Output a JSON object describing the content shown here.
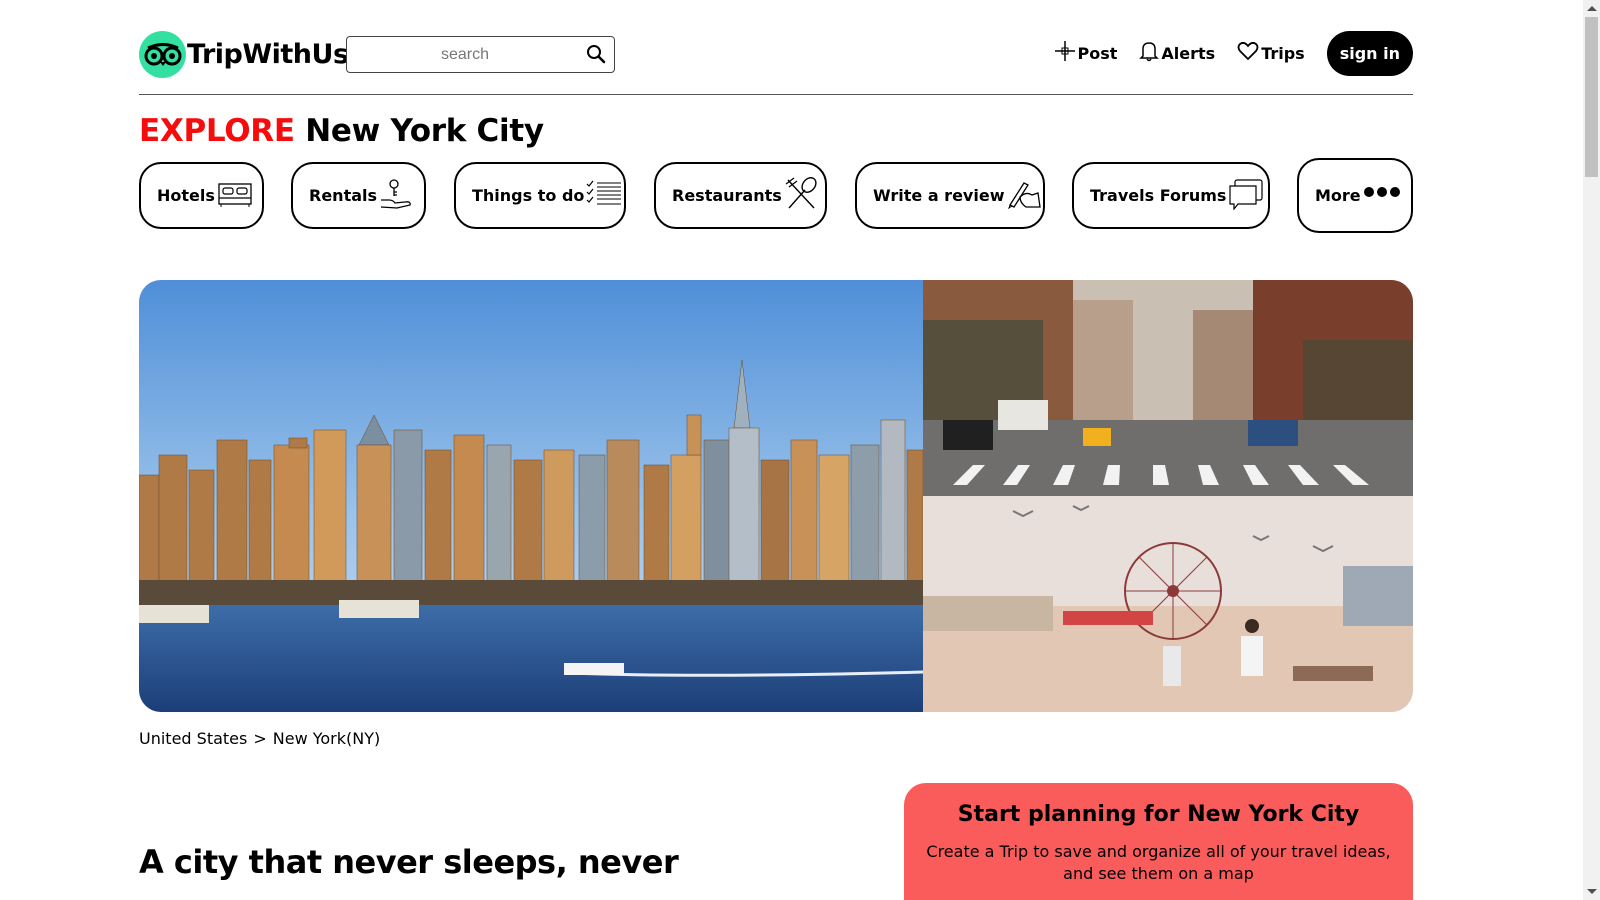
{
  "header": {
    "logo_text": "TripWithUs",
    "search_placeholder": "search",
    "nav": {
      "post": "Post",
      "alerts": "Alerts",
      "trips": "Trips",
      "signin": "sign in"
    }
  },
  "title": {
    "accent": "EXPLORE",
    "city": "New York City"
  },
  "categories": {
    "hotels": "Hotels",
    "rentals": "Rentals",
    "things": "Things to do",
    "restaurants": "Restaurants",
    "review": "Write a review",
    "forums": "Travels Forums",
    "more": "More"
  },
  "breadcrumb": {
    "country": "United States",
    "separator": ">",
    "state": "New York(NY)"
  },
  "headline": "A city that never sleeps, never",
  "plan": {
    "title": "Start planning for New York City",
    "text": "Create a Trip to save and organize all of your travel ideas, and see them on a map"
  },
  "colors": {
    "accent": "#f60c0c",
    "logo_green": "#34e0a1",
    "plan_bg": "#fa5c5c"
  }
}
